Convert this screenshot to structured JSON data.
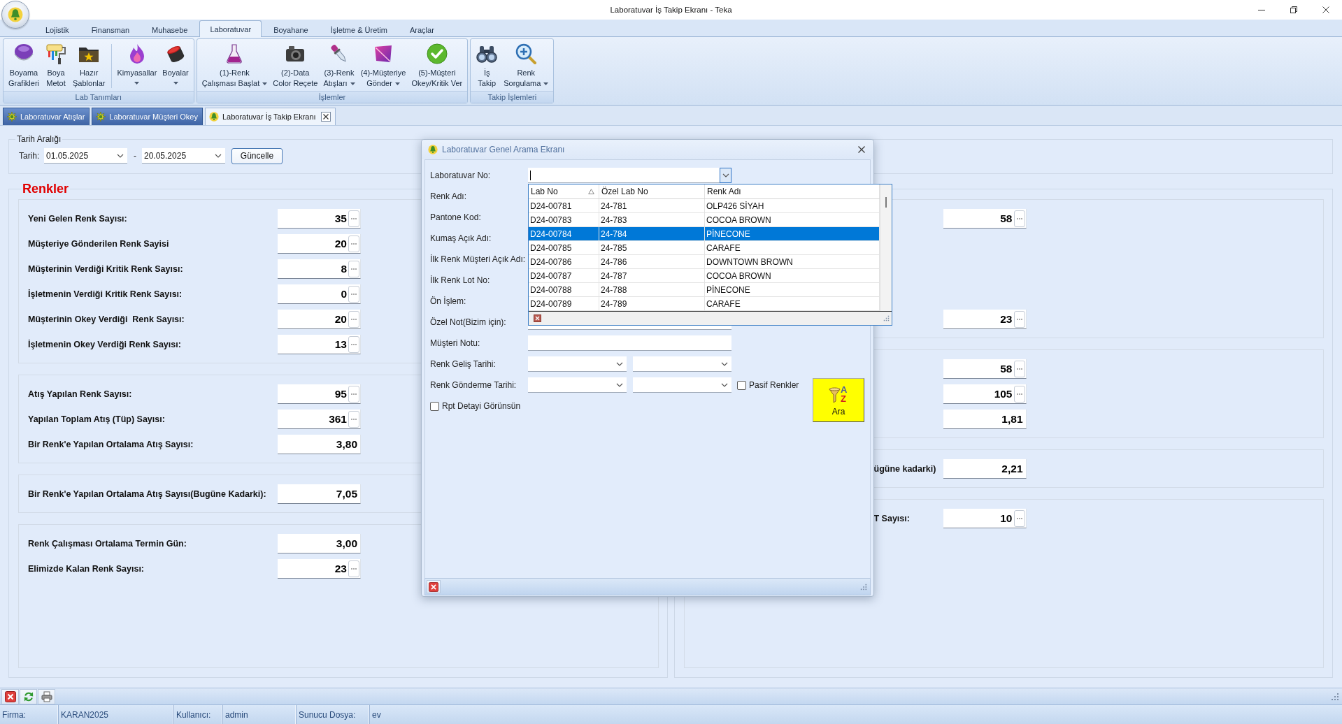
{
  "window": {
    "title": "Laboratuvar İş Takip Ekranı - Teka"
  },
  "ribbon": {
    "tabs": [
      {
        "label": "Lojistik",
        "selected": false
      },
      {
        "label": "Finansman",
        "selected": false
      },
      {
        "label": "Muhasebe",
        "selected": false
      },
      {
        "label": "Laboratuvar",
        "selected": true
      },
      {
        "label": "Boyahane",
        "selected": false
      },
      {
        "label": "İşletme & Üretim",
        "selected": false
      },
      {
        "label": "Araçlar",
        "selected": false
      }
    ],
    "groups": [
      {
        "title": "Lab Tanımları",
        "sections": [
          [
            {
              "lines": [
                "Boyama",
                "Grafikleri"
              ],
              "dropdown": false
            },
            {
              "lines": [
                "Boya",
                "Metot"
              ],
              "dropdown": false
            },
            {
              "lines": [
                "Hazır",
                "Şablonlar"
              ],
              "dropdown": false
            }
          ],
          [
            {
              "lines": [
                "Kimyasallar"
              ],
              "dropdown": true
            },
            {
              "lines": [
                "Boyalar"
              ],
              "dropdown": true
            }
          ]
        ]
      },
      {
        "title": "İşlemler",
        "sections": [
          [
            {
              "lines": [
                "(1)-Renk",
                "Çalışması Başlat"
              ],
              "dropdown": true
            },
            {
              "lines": [
                "(2)-Data",
                "Color Reçete"
              ],
              "dropdown": false
            },
            {
              "lines": [
                "(3)-Renk",
                "Atışları"
              ],
              "dropdown": true
            },
            {
              "lines": [
                "(4)-Müşteriye",
                "Gönder"
              ],
              "dropdown": true
            },
            {
              "lines": [
                "(5)-Müşteri",
                "Okey/Kritik Ver"
              ],
              "dropdown": false
            }
          ]
        ]
      },
      {
        "title": "Takip İşlemleri",
        "sections": [
          [
            {
              "lines": [
                "İş",
                "Takip"
              ],
              "dropdown": false
            },
            {
              "lines": [
                "Renk",
                "Sorgulama"
              ],
              "dropdown": true
            }
          ]
        ]
      }
    ]
  },
  "document_tabs": [
    {
      "label": "Laboratuvar Atışlar",
      "selected": false
    },
    {
      "label": "Laboratuvar Müşteri Okey",
      "selected": false
    },
    {
      "label": "Laboratuvar İş Takip Ekranı",
      "selected": true
    }
  ],
  "date_range": {
    "title": "Tarih Aralığı",
    "label": "Tarih:",
    "from": "01.05.2025",
    "separator": "-",
    "to": "20.05.2025",
    "button": "Güncelle"
  },
  "colors_panel": {
    "title": "Renkler",
    "columns": [
      {
        "sections": [
          {
            "rows": [
              {
                "label": "Yeni Gelen Renk Sayısı:",
                "value": "35",
                "details": true
              },
              {
                "label": "Müşteriye Gönderilen Renk Sayisi",
                "value": "20",
                "details": true
              },
              {
                "label": "Müşterinin Verdiği Kritik Renk Sayısı:",
                "value": "8",
                "details": true
              },
              {
                "label": "İşletmenin Verdiği Kritik Renk Sayısı:",
                "value": "0",
                "details": true
              },
              {
                "label": "Müşterinin Okey Verdiği  Renk Sayısı:",
                "value": "20",
                "details": true
              },
              {
                "label": "İşletmenin Okey Verdiği Renk Sayısı:",
                "value": "13",
                "details": true
              }
            ]
          },
          {
            "rows": [
              {
                "label": "Atış Yapılan Renk Sayısı:",
                "value": "95",
                "details": true
              },
              {
                "label": "Yapılan Toplam Atış (Tüp) Sayısı:",
                "value": "361",
                "details": true
              },
              {
                "label": "Bir Renk'e Yapılan Ortalama Atış Sayısı:",
                "value": "3,80",
                "details": false
              }
            ]
          },
          {
            "rows": [
              {
                "label": "Bir Renk'e Yapılan Ortalama Atış Sayısı(Bugüne Kadarki):",
                "value": "7,05",
                "details": false
              }
            ]
          },
          {
            "rows": [
              {
                "label": "Renk Çalışması Ortalama Termin Gün:",
                "value": "3,00",
                "details": false
              },
              {
                "label": "Elimizde Kalan Renk Sayısı:",
                "value": "23",
                "details": true
              }
            ]
          }
        ]
      },
      {
        "sections": [
          {
            "rows": [
              {
                "value": "58",
                "details": true
              },
              {
                "value": "23",
                "details": true
              }
            ]
          },
          {
            "rows": [
              {
                "value": "58",
                "details": true
              },
              {
                "value": "105",
                "details": true
              },
              {
                "value": "1,81",
                "details": false
              }
            ]
          },
          {
            "rows": [
              {
                "label": "ügüne kadarki)",
                "value": "2,21",
                "details": false
              }
            ]
          },
          {
            "rows": [
              {
                "label": "T Sayısı:",
                "value": "10",
                "details": true
              }
            ]
          }
        ]
      }
    ]
  },
  "search_dialog": {
    "title": "Laboratuvar Genel Arama Ekranı",
    "rows": [
      {
        "kind": "combo",
        "label": "Laboratuvar No:",
        "focused": true
      },
      {
        "kind": "label",
        "label": "Renk Adı:"
      },
      {
        "kind": "label",
        "label": "Pantone Kod:"
      },
      {
        "kind": "label",
        "label": "Kumaş Açık Adı:"
      },
      {
        "kind": "label",
        "label": "İlk Renk Müşteri Açık Adı:"
      },
      {
        "kind": "label",
        "label": "İlk Renk Lot No:"
      },
      {
        "kind": "label",
        "label": "Ön İşlem:"
      },
      {
        "kind": "text",
        "label": "Özel Not(Bizim için):"
      },
      {
        "kind": "text",
        "label": "Müşteri Notu:"
      },
      {
        "kind": "date_range",
        "label": "Renk Geliş Tarihi:"
      },
      {
        "kind": "date_range",
        "label": "Renk Gönderme Tarihi:",
        "check": {
          "label": "Pasif Renkler",
          "checked": false
        }
      },
      {
        "kind": "check",
        "label": "Rpt Detayi Görünsün",
        "checked": false
      }
    ],
    "search_button": {
      "label": "Ara",
      "icon_letters": [
        "A",
        "Z"
      ]
    },
    "lookup_list": {
      "columns": [
        {
          "label": "Lab No",
          "sorted": true
        },
        {
          "label": "Özel Lab No",
          "sorted": false
        },
        {
          "label": "Renk Adı",
          "sorted": false
        }
      ],
      "rows": [
        {
          "cells": [
            "D24-00781",
            "24-781",
            "OLP426 SİYAH"
          ],
          "selected": false
        },
        {
          "cells": [
            "D24-00783",
            "24-783",
            "COCOA BROWN"
          ],
          "selected": false
        },
        {
          "cells": [
            "D24-00784",
            "24-784",
            "PİNECONE"
          ],
          "selected": true
        },
        {
          "cells": [
            "D24-00785",
            "24-785",
            "CARAFE"
          ],
          "selected": false
        },
        {
          "cells": [
            "D24-00786",
            "24-786",
            "DOWNTOWN BROWN"
          ],
          "selected": false
        },
        {
          "cells": [
            "D24-00787",
            "24-787",
            "COCOA BROWN"
          ],
          "selected": false
        },
        {
          "cells": [
            "D24-00788",
            "24-788",
            "PİNECONE"
          ],
          "selected": false
        },
        {
          "cells": [
            "D24-00789",
            "24-789",
            "CARAFE"
          ],
          "selected": false
        }
      ]
    }
  },
  "status_bar": [
    "Firma:",
    "KARAN2025",
    "Kullanıcı:",
    "admin",
    "Sunucu Dosya:",
    "ev"
  ]
}
